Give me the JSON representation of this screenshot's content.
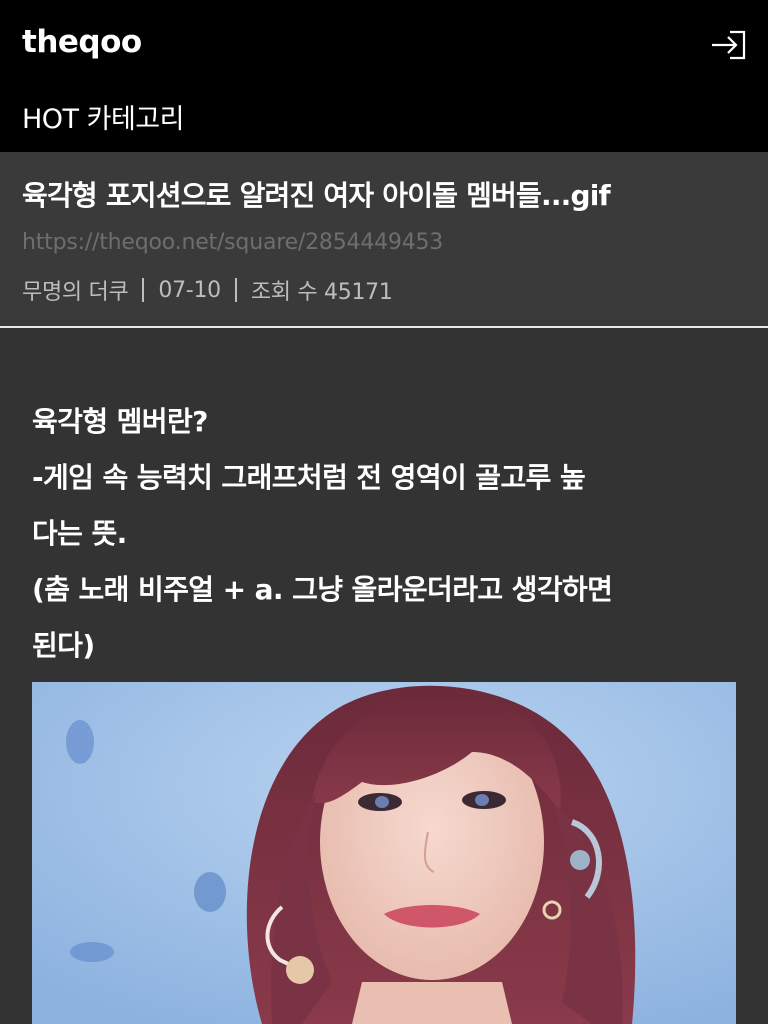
{
  "header": {
    "logo": "theqoo",
    "login_icon": "login-icon",
    "category": "HOT 카테고리"
  },
  "post": {
    "title": "육각형 포지션으로 알려진 여자 아이돌 멤버들...gif",
    "url": "https://theqoo.net/square/2854449453",
    "author": "무명의 더쿠",
    "date": "07-10",
    "views": "조회 수 45171"
  },
  "body": {
    "lines": [
      "육각형 멤버란?",
      "-게임 속 능력치 그래프처럼 전 영역이 골고루 높",
      "다는 뜻.",
      "(춤 노래 비주얼 + a. 그냥 올라운더라고 생각하면",
      "된다)"
    ]
  },
  "colors": {
    "topbar_bg": "#000000",
    "header_bg": "#3a3a3a",
    "content_bg": "#333333",
    "url_text": "#6e6e6e",
    "meta_text": "#bdbdbd"
  }
}
